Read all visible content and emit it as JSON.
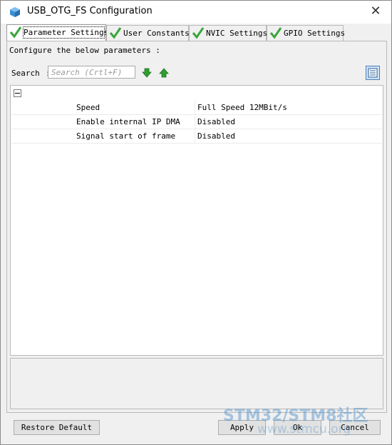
{
  "window": {
    "title": "USB_OTG_FS Configuration",
    "close_glyph": "✕"
  },
  "tabs": [
    {
      "label": "Parameter Settings",
      "active": true
    },
    {
      "label": "User Constants",
      "active": false
    },
    {
      "label": "NVIC Settings",
      "active": false
    },
    {
      "label": "GPIO Settings",
      "active": false
    }
  ],
  "panel": {
    "configure_text": "Configure the below parameters :",
    "search_label": "Search",
    "search_sep": ":",
    "search_placeholder": "Search (Crtl+F)",
    "icons": [
      "arrow-down-icon",
      "arrow-up-icon",
      "list-view-icon"
    ]
  },
  "parameters": [
    {
      "name": "Speed",
      "value": "Full Speed 12MBit/s"
    },
    {
      "name": "Enable internal IP DMA",
      "value": "Disabled"
    },
    {
      "name": "Signal start of frame",
      "value": "Disabled"
    }
  ],
  "buttons": {
    "restore_default": "Restore Default",
    "apply": "Apply",
    "ok": "Ok",
    "cancel": "Cancel"
  },
  "watermark": {
    "line1": "STM32/STM8社区",
    "line2": "www.stmcu.org"
  },
  "colors": {
    "check_green": "#3aa53a",
    "arrow_green": "#2e9e2e",
    "accent_blue": "#4a7ebb"
  }
}
